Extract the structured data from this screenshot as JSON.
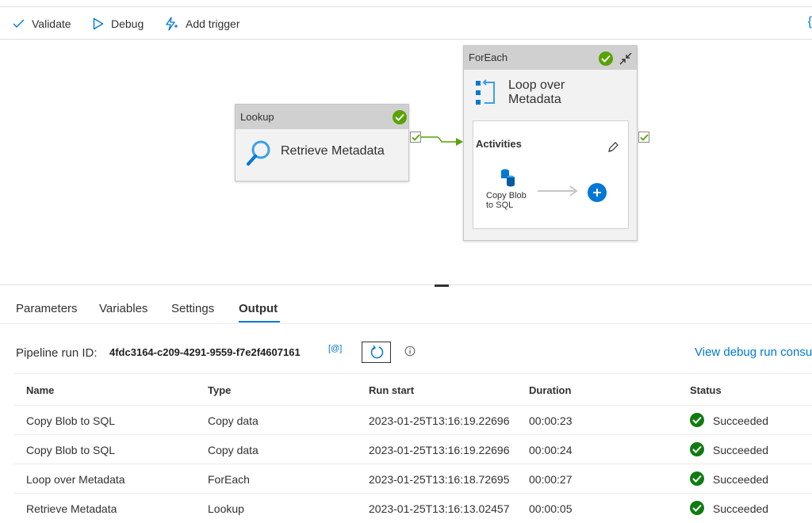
{
  "toolbar": {
    "validate_label": "Validate",
    "debug_label": "Debug",
    "add_trigger_label": "Add trigger",
    "code_brace": "{"
  },
  "canvas": {
    "lookup": {
      "type_label": "Lookup",
      "name": "Retrieve Metadata"
    },
    "foreach": {
      "type_label": "ForEach",
      "name_line1": "Loop over",
      "name_line2": "Metadata",
      "activities_label": "Activities",
      "inner_activity_line1": "Copy Blob",
      "inner_activity_line2": "to SQL"
    }
  },
  "tabs": [
    {
      "label": "Parameters"
    },
    {
      "label": "Variables"
    },
    {
      "label": "Settings"
    },
    {
      "label": "Output"
    }
  ],
  "run": {
    "id_label": "Pipeline run ID:",
    "id_value": "4fdc3164-c209-4291-9559-f7e2f4607161",
    "copy_label": "[@]",
    "view_link": "View debug run consu"
  },
  "table": {
    "headers": [
      "Name",
      "Type",
      "Run start",
      "Duration",
      "Status"
    ],
    "rows": [
      {
        "name": "Copy Blob to SQL",
        "type": "Copy data",
        "run_start": "2023-01-25T13:16:19.22696",
        "duration": "00:00:23",
        "status": "Succeeded"
      },
      {
        "name": "Copy Blob to SQL",
        "type": "Copy data",
        "run_start": "2023-01-25T13:16:19.22696",
        "duration": "00:00:24",
        "status": "Succeeded"
      },
      {
        "name": "Loop over Metadata",
        "type": "ForEach",
        "run_start": "2023-01-25T13:16:18.72695",
        "duration": "00:00:27",
        "status": "Succeeded"
      },
      {
        "name": "Retrieve Metadata",
        "type": "Lookup",
        "run_start": "2023-01-25T13:16:13.02457",
        "duration": "00:00:05",
        "status": "Succeeded"
      }
    ]
  },
  "colors": {
    "accent": "#0078d4",
    "success": "#57a300",
    "status_success": "#107c10"
  }
}
